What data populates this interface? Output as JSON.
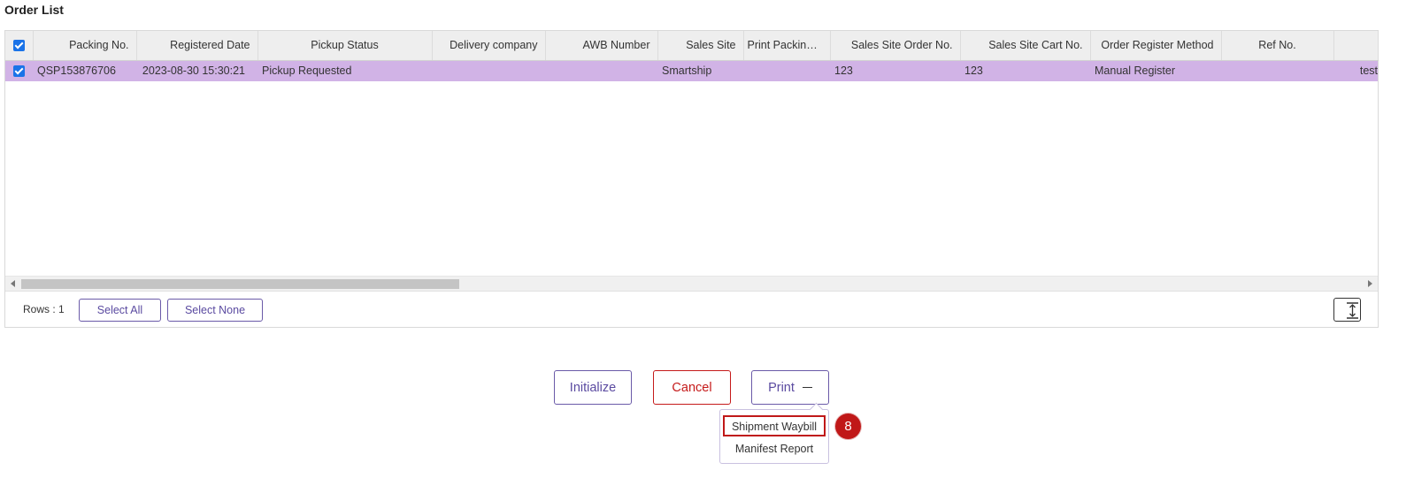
{
  "page": {
    "title": "Order List"
  },
  "grid": {
    "columns": [
      "Packing No.",
      "Registered Date",
      "Pickup Status",
      "Delivery company",
      "AWB Number",
      "Sales Site",
      "Print Packing ...",
      "Sales Site Order No.",
      "Sales Site Cart No.",
      "Order Register Method",
      "Ref No.",
      ""
    ],
    "rows": [
      {
        "packing_no": "QSP153876706",
        "registered_date": "2023-08-30 15:30:21",
        "pickup_status": "Pickup Requested",
        "delivery_company": "",
        "awb_number": "",
        "sales_site": "Smartship",
        "print_packing": "",
        "sales_site_order_no": "123",
        "sales_site_cart_no": "123",
        "order_register_method": "Manual Register",
        "ref_no": "",
        "extra": "test"
      }
    ],
    "footer": {
      "rows_label": "Rows : 1",
      "select_all": "Select All",
      "select_none": "Select None"
    }
  },
  "actions": {
    "initialize": "Initialize",
    "cancel": "Cancel",
    "print": "Print"
  },
  "print_menu": {
    "items": [
      "Shipment Waybill",
      "Manifest Report"
    ]
  },
  "annotation": {
    "step": "8"
  },
  "colors": {
    "selected_row": "#d1b3e6",
    "accent": "#5a4aa0",
    "danger": "#c51a1a",
    "checkbox": "#1a73e8"
  }
}
